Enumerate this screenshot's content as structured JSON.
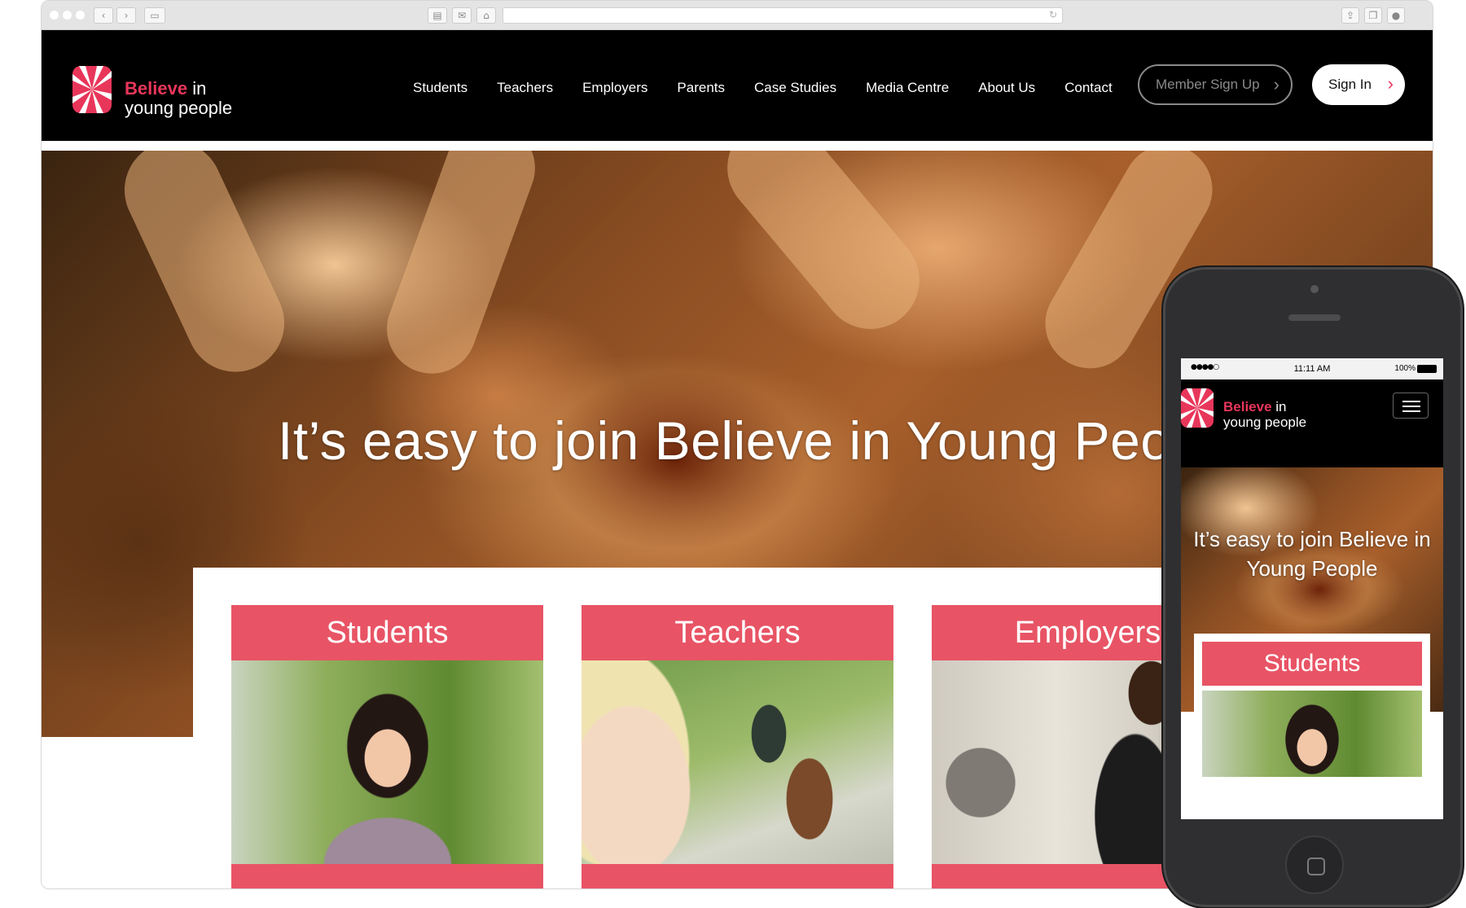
{
  "brand": {
    "accent": "#e8365a",
    "card_color": "#e85465",
    "logo_word1": "Believe",
    "logo_word2": "in",
    "logo_line2": "young people"
  },
  "desktop": {
    "nav": [
      "Students",
      "Teachers",
      "Employers",
      "Parents",
      "Case Studies",
      "Media Centre",
      "About Us",
      "Contact"
    ],
    "member_button": "Member Sign Up",
    "signin_button": "Sign In",
    "hero_title": "It’s easy to join Believe in Young People",
    "cards": [
      "Students",
      "Teachers",
      "Employers"
    ]
  },
  "mobile": {
    "status": {
      "time": "11:11 AM",
      "battery": "100%"
    },
    "hero_title": "It’s easy to join Believe in Young People",
    "card": "Students"
  },
  "icons": {
    "chevron": "›",
    "reload": "↻"
  }
}
